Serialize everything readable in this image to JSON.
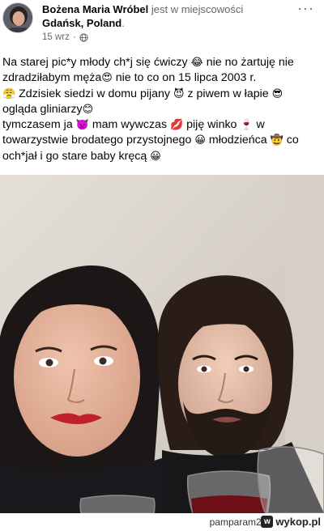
{
  "post": {
    "author": "Bożena Maria Wróbel",
    "location_prefix": "jest w miejscowości",
    "location": "Gdańsk, Poland",
    "location_suffix": ".",
    "time": "15 wrz",
    "separator": "·",
    "more_label": "···",
    "privacy_icon": "globe-icon",
    "text": {
      "p1_a": "Na starej pic*y młody ch*j się ćwiczy",
      "p1_e1": "😂",
      "p1_b": "nie no żartuję nie zdradziłabym męża",
      "p1_e2": "😍",
      "p1_c": "nie to co on 15 lipca 2003 r.",
      "p2_e1": "😤",
      "p2_a": "Zdzisiek siedzi w domu pijany",
      "p2_e2": "😈",
      "p2_b": "z piwem w łapie",
      "p2_e3": "😎",
      "p2_c": "ogląda gliniarzy",
      "p2_e4": "😊",
      "p3_a": "tymczasem ja",
      "p3_e1": "👿",
      "p3_b": "mam wywczas",
      "p3_e2": "💋",
      "p3_c": "piję winko",
      "p3_e3": "🍷",
      "p3_d": "w towarzystwie brodatego przystojnego",
      "p3_e4": "😀",
      "p3_e": "młodzieńca",
      "p3_e5": "🤠",
      "p3_f": "co och*jał i go stare baby kręcą",
      "p3_e6": "😀"
    }
  },
  "footer": {
    "user": "pamparam2",
    "separator": "z",
    "logo_text": "wykop.pl",
    "logo_mark": "w"
  },
  "colors": {
    "text": "#050505",
    "muted": "#65676b",
    "photo_wall": "#d8d3cc"
  }
}
